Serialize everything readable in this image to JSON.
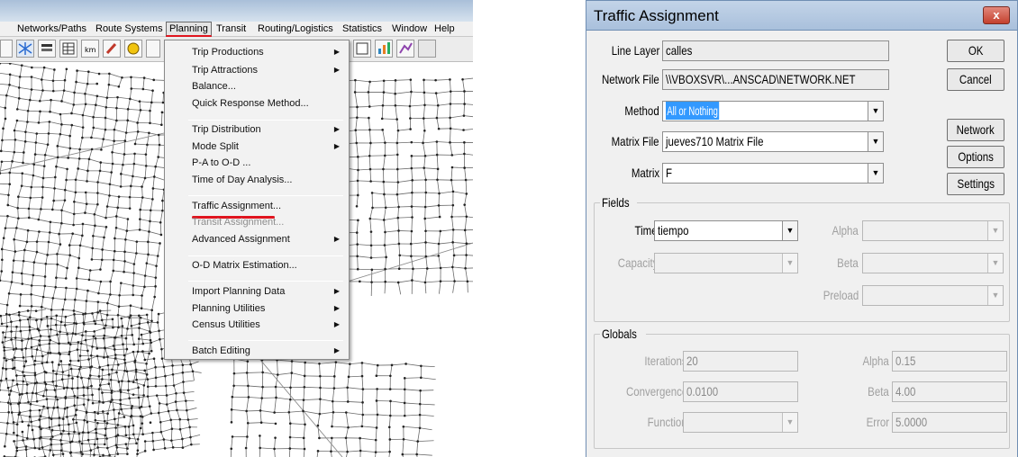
{
  "menubar": {
    "items": [
      "Networks/Paths",
      "Route Systems",
      "Planning",
      "Transit",
      "Routing/Logistics",
      "Statistics",
      "Window",
      "Help"
    ],
    "active": "Planning"
  },
  "planning_menu": {
    "items": [
      {
        "label": "Trip Productions",
        "submenu": true
      },
      {
        "label": "Trip Attractions",
        "submenu": true
      },
      {
        "label": "Balance...",
        "submenu": false
      },
      {
        "label": "Quick Response Method...",
        "submenu": false
      },
      {
        "label": "Trip Distribution",
        "submenu": true
      },
      {
        "label": "Mode Split",
        "submenu": true
      },
      {
        "label": "P-A to O-D ...",
        "submenu": false
      },
      {
        "label": "Time of Day Analysis...",
        "submenu": false
      },
      {
        "label": "Traffic Assignment...",
        "submenu": false,
        "highlighted": true
      },
      {
        "label": "Transit Assignment...",
        "submenu": false,
        "disabled": true
      },
      {
        "label": "Advanced Assignment",
        "submenu": true
      },
      {
        "label": "O-D Matrix Estimation...",
        "submenu": false
      },
      {
        "label": "Import Planning Data",
        "submenu": true
      },
      {
        "label": "Planning Utilities",
        "submenu": true
      },
      {
        "label": "Census Utilities",
        "submenu": true
      },
      {
        "label": "Batch Editing",
        "submenu": true
      }
    ],
    "submenu_arrow": "▶"
  },
  "dialog": {
    "title": "Traffic Assignment",
    "close_glyph": "x",
    "line_layer": {
      "label": "Line Layer",
      "value": "calles"
    },
    "network_file": {
      "label": "Network File",
      "value": "\\\\VBOXSVR\\...ANSCAD\\NETWORK.NET"
    },
    "method": {
      "label": "Method",
      "value": "All or Nothing"
    },
    "matrix_file": {
      "label": "Matrix File",
      "value": "jueves710 Matrix File"
    },
    "matrix": {
      "label": "Matrix",
      "value": "F"
    },
    "buttons": {
      "ok": "OK",
      "cancel": "Cancel",
      "network": "Network",
      "options": "Options",
      "settings": "Settings"
    },
    "fields_group": {
      "title": "Fields",
      "time": {
        "label": "Time",
        "value": "tiempo"
      },
      "capacity": {
        "label": "Capacity",
        "value": ""
      },
      "alpha": {
        "label": "Alpha",
        "value": ""
      },
      "beta": {
        "label": "Beta",
        "value": ""
      },
      "preload": {
        "label": "Preload",
        "value": ""
      }
    },
    "globals_group": {
      "title": "Globals",
      "iterations": {
        "label": "Iterations",
        "value": "20"
      },
      "convergence": {
        "label": "Convergence",
        "value": "0.0100"
      },
      "function": {
        "label": "Function",
        "value": ""
      },
      "alpha": {
        "label": "Alpha",
        "value": "0.15"
      },
      "beta": {
        "label": "Beta",
        "value": "4.00"
      },
      "error": {
        "label": "Error",
        "value": "5.0000"
      }
    }
  },
  "colors": {
    "annotation_red": "#e0141e",
    "selection_blue": "#3399ff"
  }
}
